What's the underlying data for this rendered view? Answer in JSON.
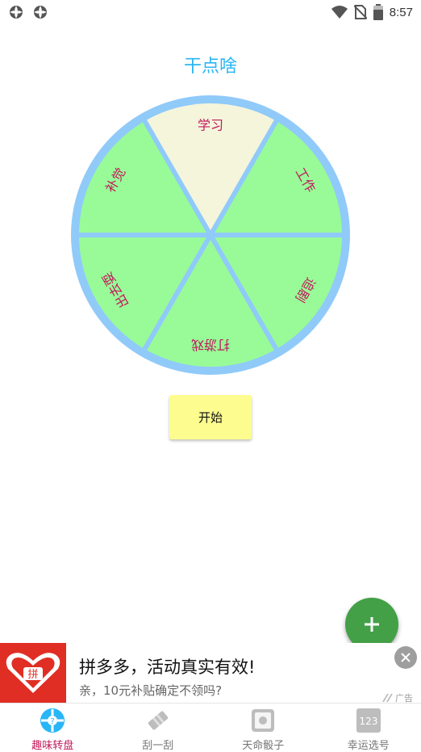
{
  "status_bar": {
    "time": "8:57",
    "left_icons": [
      "app-notification-icon",
      "app-notification-icon"
    ],
    "right_icons": [
      "wifi-icon",
      "no-sim-icon",
      "battery-icon"
    ]
  },
  "title": "干点啥",
  "wheel": {
    "segments": [
      "学习",
      "工作",
      "追剧",
      "打游戏",
      "出去耍",
      "补觉"
    ],
    "segment_colors": [
      "#f5f5dc",
      "#98fb98",
      "#98fb98",
      "#98fb98",
      "#98fb98",
      "#98fb98"
    ],
    "rim_color": "#90caf9",
    "text_color": "#c2185b"
  },
  "start_button": "开始",
  "fab": {
    "icon": "plus-icon",
    "color": "#43a047"
  },
  "ad": {
    "logo_text": "拼",
    "title": "拼多多，活动真实有效!",
    "subtitle": "亲，10元补贴确定不领吗?",
    "tag": "广告",
    "close_icon": "close-icon"
  },
  "bottom_nav": [
    {
      "label": "趣味转盘",
      "icon": "wheel-icon",
      "active": true
    },
    {
      "label": "刮一刮",
      "icon": "scratch-icon",
      "active": false
    },
    {
      "label": "天命骰子",
      "icon": "dice-icon",
      "active": false
    },
    {
      "label": "幸运选号",
      "icon": "number-icon",
      "icon_text": "123",
      "active": false
    }
  ],
  "colors": {
    "accent": "#29b6f6",
    "active_nav": "#c2185b",
    "button_bg": "#fdfd8f"
  }
}
